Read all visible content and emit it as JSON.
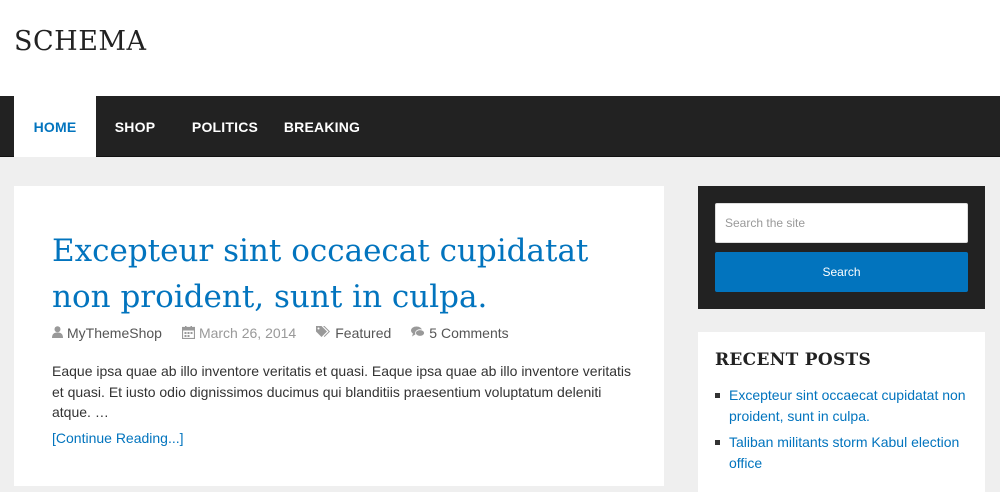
{
  "site": {
    "title": "SCHEMA"
  },
  "nav": {
    "items": [
      {
        "label": "HOME"
      },
      {
        "label": "SHOP"
      },
      {
        "label": "POLITICS"
      },
      {
        "label": "BREAKING"
      }
    ]
  },
  "post": {
    "title": "Excepteur sint occaecat cupidatat non proident, sunt in culpa.",
    "author": "MyThemeShop",
    "date": "March 26, 2014",
    "category": "Featured",
    "comments": "5 Comments",
    "excerpt": "Eaque ipsa quae ab illo inventore veritatis et quasi. Eaque ipsa quae ab illo inventore veritatis et quasi. Et iusto odio dignissimos ducimus qui blanditiis praesentium voluptatum deleniti atque. …",
    "read_more": "[Continue Reading...]"
  },
  "search": {
    "placeholder": "Search the site",
    "button_label": "Search"
  },
  "recent_posts": {
    "heading": "RECENT POSTS",
    "items": [
      {
        "title": "Excepteur sint occaecat cupidatat non proident, sunt in culpa."
      },
      {
        "title": "Taliban militants storm Kabul election office"
      }
    ]
  },
  "icons": {
    "author": "user-icon",
    "date": "calendar-icon",
    "category": "tags-icon",
    "comments": "comments-icon"
  },
  "colors": {
    "accent": "#0274be",
    "nav_background": "#222222",
    "page_background": "#efefef"
  }
}
